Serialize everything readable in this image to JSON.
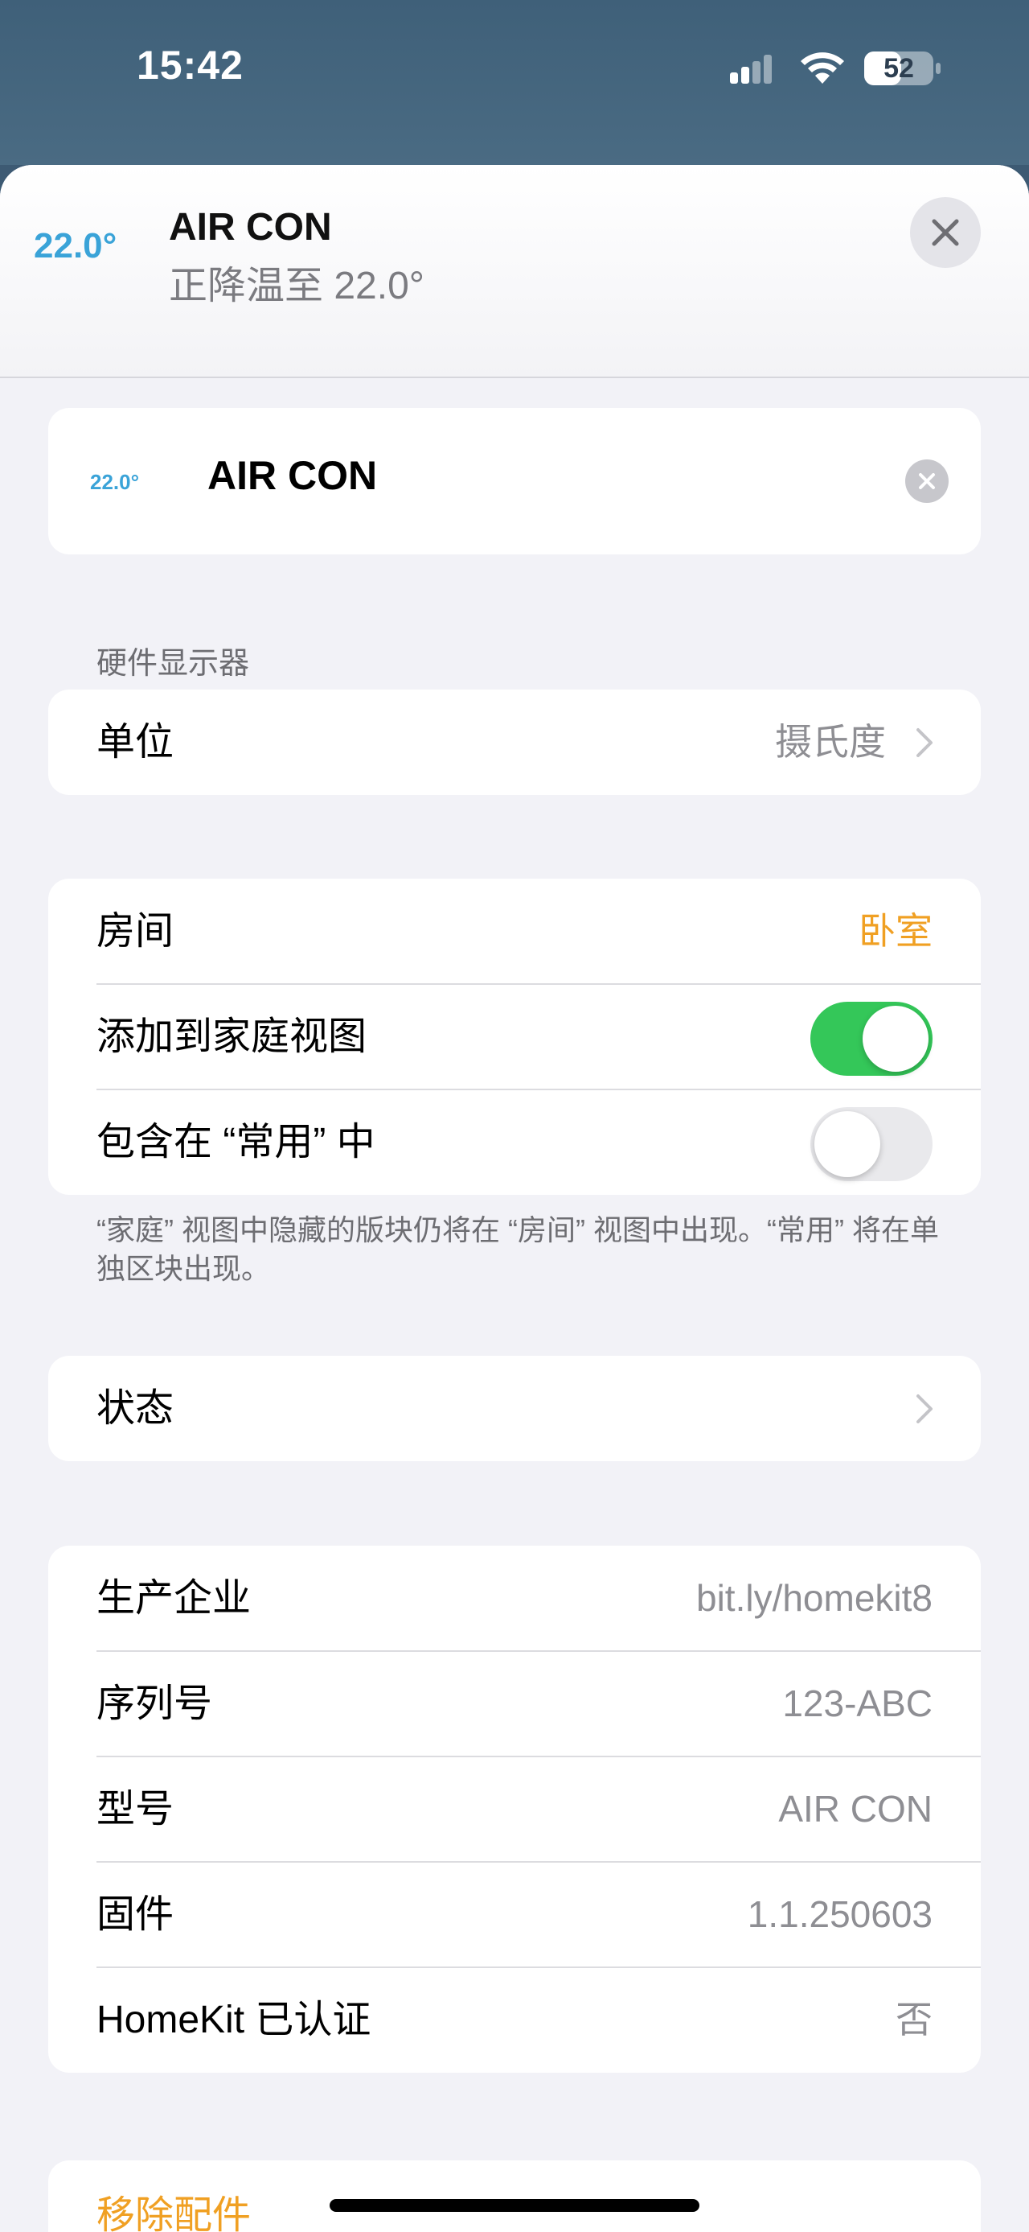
{
  "status_bar": {
    "time": "15:42",
    "battery": "52",
    "signal_icon": "cellular-signal-icon",
    "wifi_icon": "wifi-icon",
    "battery_icon": "battery-icon"
  },
  "header": {
    "temperature": "22.0°",
    "title": "AIR CON",
    "subtitle": "正降温至 22.0°",
    "close_icon": "close-icon"
  },
  "name_card": {
    "temperature": "22.0°",
    "name": "AIR CON",
    "clear_icon": "clear-icon"
  },
  "hardware_section": {
    "caption": "硬件显示器",
    "unit_label": "单位",
    "unit_value": "摄氏度"
  },
  "room_section": {
    "room_label": "房间",
    "room_value": "卧室",
    "add_home_label": "添加到家庭视图",
    "add_home_on": true,
    "favorites_label": "包含在 “常用” 中",
    "favorites_on": false,
    "note": "“家庭” 视图中隐藏的版块仍将在 “房间” 视图中出现。“常用” 将在单独区块出现。"
  },
  "status_section": {
    "label": "状态"
  },
  "info_section": {
    "rows": [
      {
        "label": "生产企业",
        "value": "bit.ly/homekit8"
      },
      {
        "label": "序列号",
        "value": "123-ABC"
      },
      {
        "label": "型号",
        "value": "AIR CON"
      },
      {
        "label": "固件",
        "value": "1.1.250603"
      },
      {
        "label": "HomeKit 已认证",
        "value": "否"
      }
    ]
  },
  "remove_section": {
    "label": "移除配件"
  },
  "colors": {
    "accent_orange": "#f0a023",
    "temp_blue": "#3aa3d8",
    "toggle_green": "#34c759"
  }
}
